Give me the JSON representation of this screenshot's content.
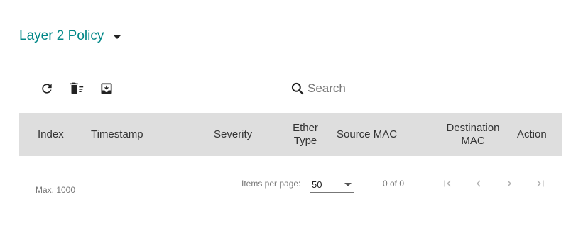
{
  "header": {
    "title": "Layer 2 Policy"
  },
  "toolbar": {
    "refresh_icon": "refresh-icon",
    "delete_all_icon": "delete-sweep-icon",
    "export_icon": "download-icon"
  },
  "search": {
    "placeholder": "Search",
    "value": ""
  },
  "table": {
    "columns": [
      "Index",
      "Timestamp",
      "Severity",
      "Ether Type",
      "Source MAC",
      "Destination MAC",
      "Action"
    ],
    "rows": []
  },
  "footer": {
    "max_label": "Max. 1000",
    "items_per_page_label": "Items per page:",
    "items_per_page_value": "50",
    "range": "0 of 0"
  },
  "colors": {
    "accent": "#008787",
    "header_bg": "#dedede",
    "pager_disabled": "#b0b0b0"
  }
}
